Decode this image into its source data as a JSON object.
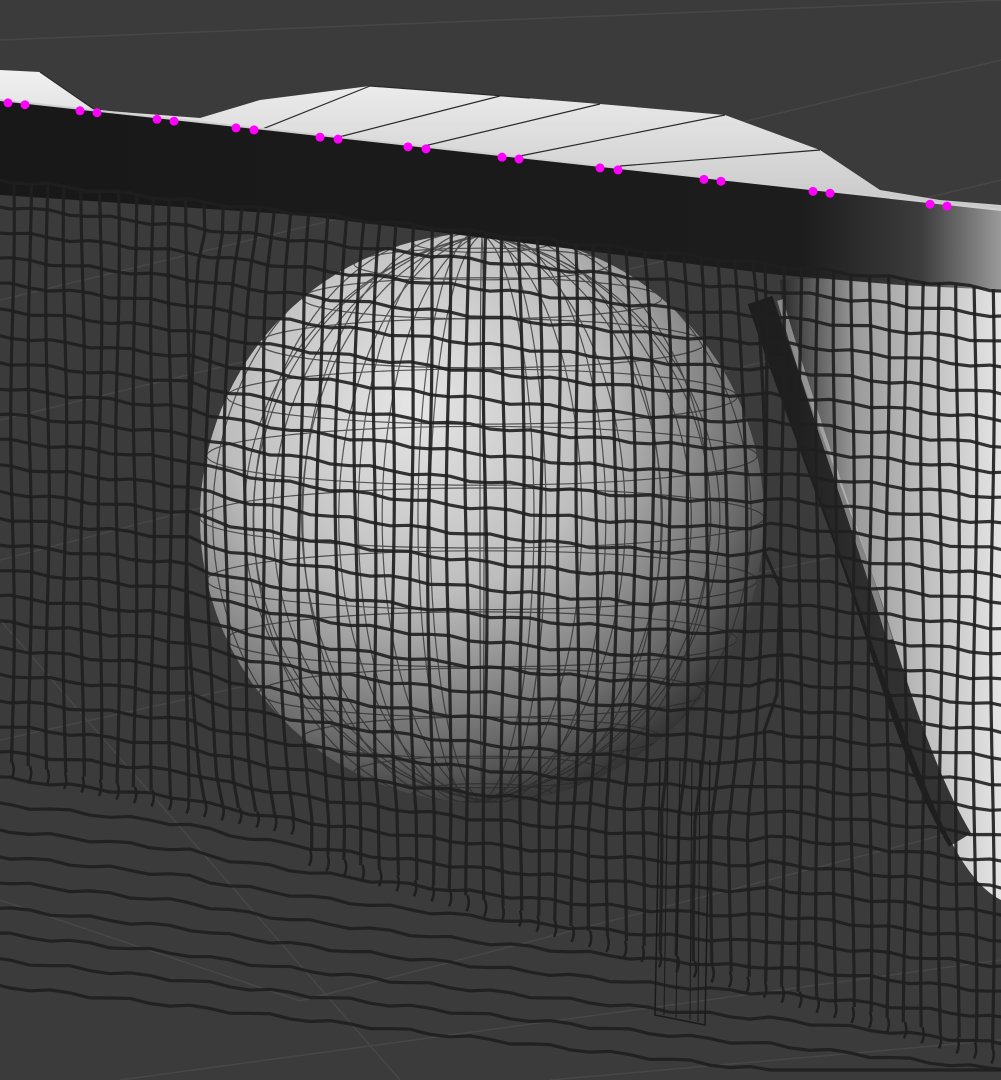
{
  "viewport": {
    "background_color": "#3b3b3b",
    "floor_grid_color": "#474747",
    "mesh_color": "#1c1c1c",
    "surface_light_color": "#e0e0e0",
    "surface_dark_color": "#3a3a3a",
    "pinned_vertex_color": "#ff00ff"
  },
  "scene": {
    "objects": [
      {
        "icon": "cloth-net-mesh-icon",
        "role": "cloth"
      },
      {
        "icon": "collider-sphere-icon",
        "role": "collider"
      },
      {
        "icon": "collider-cylinder-icon",
        "role": "collider"
      },
      {
        "icon": "pinned-vertex-icon",
        "role": "pin-constraints"
      }
    ]
  }
}
